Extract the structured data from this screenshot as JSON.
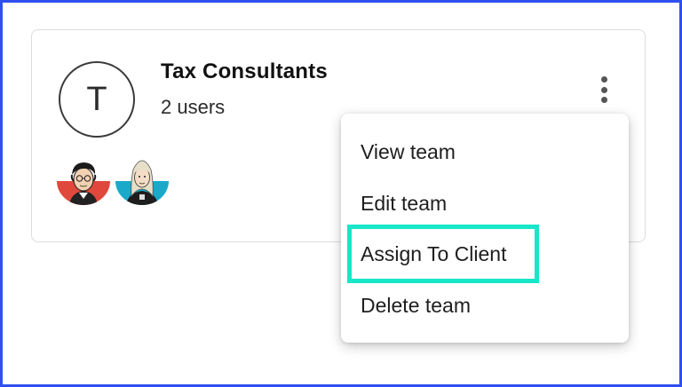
{
  "team": {
    "initial": "T",
    "name": "Tax Consultants",
    "user_count": "2 users",
    "members": [
      {
        "avatar": "member-avatar-man",
        "bg_color": "#e0483c"
      },
      {
        "avatar": "member-avatar-woman",
        "bg_color": "#1aa9c9"
      }
    ],
    "more_icon": "vertical-dots-icon"
  },
  "menu": {
    "items": [
      {
        "label": "View team"
      },
      {
        "label": "Edit team"
      },
      {
        "label": "Assign To Client",
        "highlighted": true
      },
      {
        "label": "Delete team"
      }
    ]
  },
  "colors": {
    "frame_border": "#2f4ff0",
    "highlight": "#17e6c8"
  }
}
